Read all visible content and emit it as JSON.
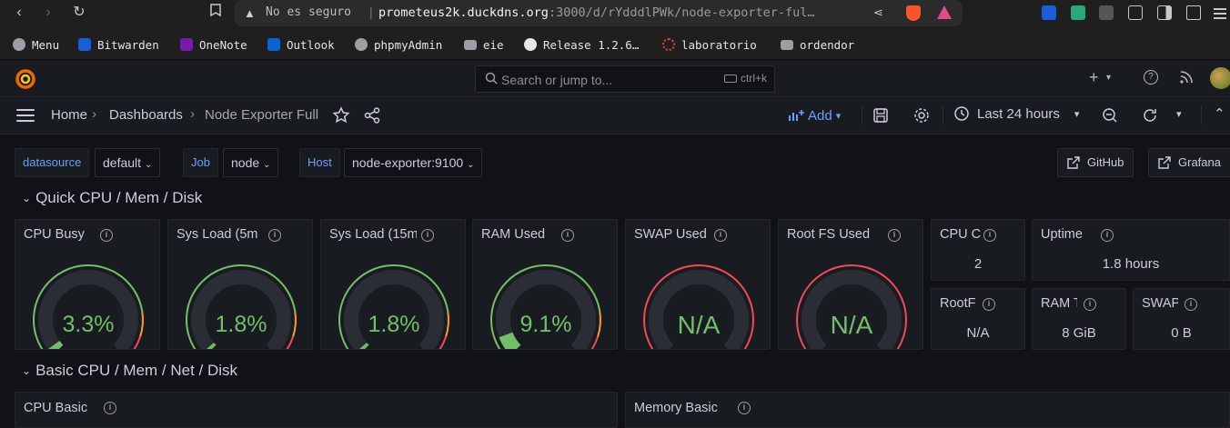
{
  "browser": {
    "url_warning": "No es seguro",
    "url_host": "prometeus2k.duckdns.org",
    "url_path": ":3000/d/rYdddlPWk/node-exporter-ful…",
    "bookmarks": [
      {
        "label": "Menu",
        "icon": "globe-icon",
        "color": "#9aa0a6"
      },
      {
        "label": "Bitwarden",
        "icon": "bitwarden-icon",
        "color": "#175ddc"
      },
      {
        "label": "OneNote",
        "icon": "onenote-icon",
        "color": "#7719aa"
      },
      {
        "label": "Outlook",
        "icon": "outlook-icon",
        "color": "#0a64d0"
      },
      {
        "label": "phpmyAdmin",
        "icon": "globe-icon",
        "color": "#9aa0a6"
      },
      {
        "label": "eie",
        "icon": "folder-icon",
        "color": "#9aa0a6"
      },
      {
        "label": "Release 1.2.6…",
        "icon": "github-icon",
        "color": "#e6e6e6"
      },
      {
        "label": "laboratorio",
        "icon": "dotted-circle-icon",
        "color": "#e04040"
      },
      {
        "label": "ordendor",
        "icon": "folder-icon",
        "color": "#9aa0a6"
      }
    ]
  },
  "grafana": {
    "search_placeholder": "Search or jump to...",
    "search_shortcut": "ctrl+k",
    "breadcrumb": [
      "Home",
      "Dashboards",
      "Node Exporter Full"
    ],
    "add_label": "Add",
    "time_range": "Last 24 hours",
    "variables": [
      {
        "label": "datasource",
        "value": "default"
      },
      {
        "label": "Job",
        "value": "node"
      },
      {
        "label": "Host",
        "value": "node-exporter:9100"
      }
    ],
    "links": [
      "GitHub",
      "Grafana"
    ],
    "rows": [
      "Quick CPU / Mem / Disk",
      "Basic CPU / Mem / Net / Disk"
    ],
    "gauges": [
      {
        "title": "CPU Busy",
        "value": "3.3%",
        "level": 0.033
      },
      {
        "title": "Sys Load (5m",
        "value": "1.8%",
        "level": 0.018
      },
      {
        "title": "Sys Load (15m",
        "value": "1.8%",
        "level": 0.018
      },
      {
        "title": "RAM Used",
        "value": "9.1%",
        "level": 0.091
      },
      {
        "title": "SWAP Used",
        "value": "N/A",
        "level": null
      },
      {
        "title": "Root FS Used",
        "value": "N/A",
        "level": null
      }
    ],
    "stats": [
      {
        "title": "CPU C",
        "value": "2"
      },
      {
        "title": "Uptime",
        "value": "1.8 hours"
      },
      {
        "title": "RootF",
        "value": "N/A"
      },
      {
        "title": "RAM T",
        "value": "8 GiB"
      },
      {
        "title": "SWAP",
        "value": "0 B"
      }
    ],
    "bottom_panels": [
      "CPU Basic",
      "Memory Basic"
    ],
    "colors": {
      "green": "#73bf69",
      "red": "#f2495c",
      "orange": "#ff9830",
      "accent": "#6e9fff"
    }
  }
}
